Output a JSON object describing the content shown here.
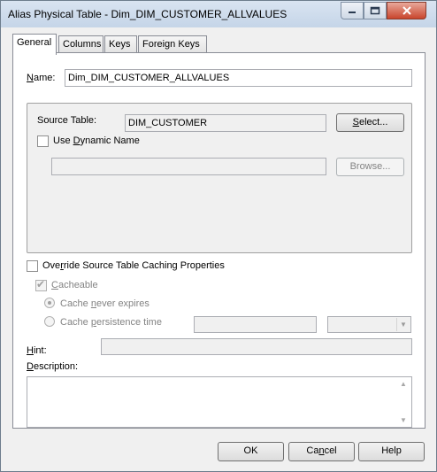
{
  "window": {
    "title": "Alias Physical Table - Dim_DIM_CUSTOMER_ALLVALUES"
  },
  "tabs": [
    {
      "label": "General"
    },
    {
      "label": "Columns"
    },
    {
      "label": "Keys"
    },
    {
      "label": "Foreign Keys"
    }
  ],
  "general": {
    "name_label": "ame:",
    "name_accel": "N",
    "name_value": "Dim_DIM_CUSTOMER_ALLVALUES",
    "source_table_label": "Source Table:",
    "source_table_value": "DIM_CUSTOMER",
    "select_button": "elect...",
    "select_accel": "S",
    "use_dynamic_pre": "Use ",
    "use_dynamic_accel": "D",
    "use_dynamic_post": "ynamic Name",
    "use_dynamic_checked": false,
    "dynamic_name_value": "",
    "browse_button": "Browse...",
    "override_pre": "Ove",
    "override_accel": "r",
    "override_post": "ride Source Table Caching Properties",
    "override_checked": false,
    "cacheable_accel": "C",
    "cacheable_post": "acheable",
    "cacheable_checked": true,
    "cache_never_pre": "Cache ",
    "cache_never_accel": "n",
    "cache_never_post": "ever expires",
    "cache_persist_pre": "Cache ",
    "cache_persist_accel": "p",
    "cache_persist_post": "ersistence time",
    "hint_accel": "H",
    "hint_post": "int:",
    "hint_value": "",
    "description_accel": "D",
    "description_post": "escription:",
    "description_value": ""
  },
  "footer": {
    "ok": "OK",
    "cancel_pre": "Ca",
    "cancel_accel": "n",
    "cancel_post": "cel",
    "help": "Help"
  }
}
